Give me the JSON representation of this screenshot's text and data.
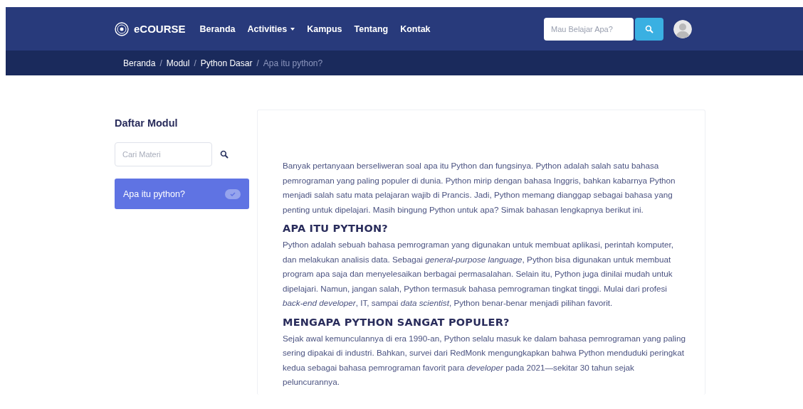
{
  "navbar": {
    "brand": "eCOURSE",
    "links": [
      {
        "label": "Beranda",
        "kind": "link"
      },
      {
        "label": "Activities",
        "kind": "dropdown"
      },
      {
        "label": "Kampus",
        "kind": "link"
      },
      {
        "label": "Tentang",
        "kind": "link"
      },
      {
        "label": "Kontak",
        "kind": "link"
      }
    ],
    "search": {
      "placeholder": "Mau Belajar Apa?"
    }
  },
  "breadcrumb_separator": "/",
  "breadcrumb": [
    {
      "label": "Beranda",
      "current": false
    },
    {
      "label": "Modul",
      "current": false
    },
    {
      "label": "Python Dasar",
      "current": false
    },
    {
      "label": "Apa itu python?",
      "current": true
    }
  ],
  "sidebar": {
    "title": "Daftar Modul",
    "search": {
      "placeholder": "Cari Materi"
    },
    "items": [
      {
        "label": "Apa itu python?",
        "selected": true,
        "completed": true
      }
    ]
  },
  "article": [
    {
      "kind": "paragraph",
      "text": "Banyak pertanyaan berseliweran soal apa itu Python dan fungsinya. Python adalah salah satu bahasa pemrograman yang paling populer di dunia. Python mirip dengan bahasa Inggris, bahkan kabarnya Python menjadi salah satu mata pelajaran wajib di Prancis. Jadi, Python memang dianggap sebagai bahasa yang penting untuk dipelajari. Masih bingung Python untuk apa? Simak bahasan lengkapnya berikut ini."
    },
    {
      "kind": "heading",
      "text": "APA ITU PYTHON?"
    },
    {
      "kind": "paragraph",
      "text": "Python adalah sebuah bahasa pemrograman yang digunakan untuk membuat aplikasi, perintah komputer, dan melakukan analisis data. Sebagai *general-purpose language*, Python bisa digunakan untuk membuat program apa saja dan menyelesaikan berbagai permasalahan. Selain itu, Python juga dinilai mudah untuk dipelajari. Namun, jangan salah, Python termasuk bahasa pemrograman tingkat tinggi. Mulai dari profesi *back-end developer*, IT, sampai *data scientist*, Python benar-benar menjadi pilihan favorit."
    },
    {
      "kind": "heading",
      "text": "MENGAPA PYTHON SANGAT POPULER?"
    },
    {
      "kind": "paragraph",
      "text": "Sejak awal kemunculannya di era 1990-an, Python selalu masuk ke dalam bahasa pemrograman yang paling sering dipakai di industri. Bahkan, survei dari RedMonk mengungkapkan bahwa Python menduduki peringkat kedua sebagai bahasa pemrograman favorit para *developer* pada 2021—sekitar 30 tahun sejak peluncurannya."
    }
  ]
}
